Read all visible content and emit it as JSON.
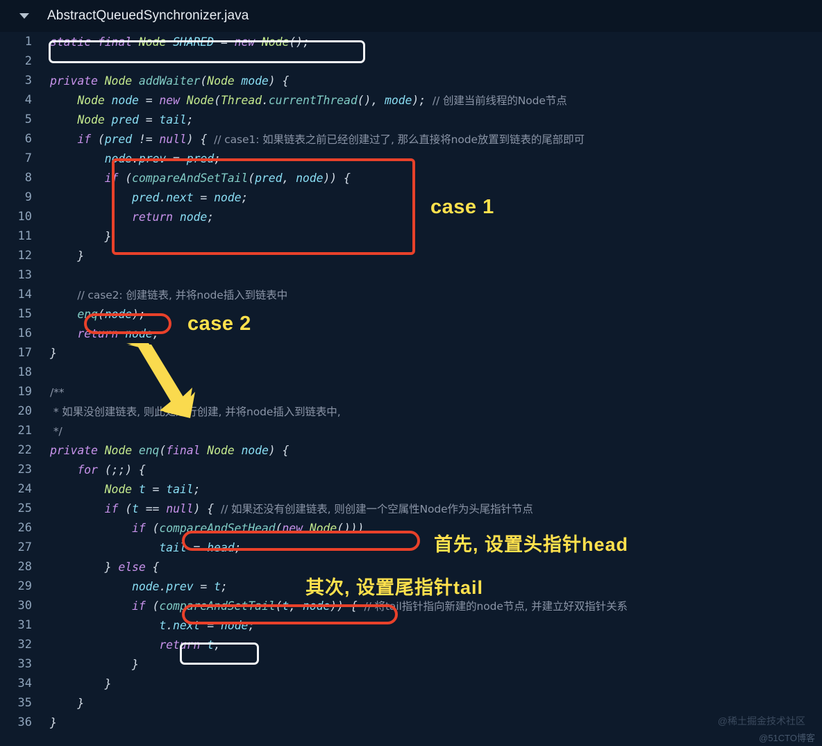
{
  "titlebar": {
    "filename": "AbstractQueuedSynchronizer.java",
    "fold_icon": "chevron-down-icon"
  },
  "editor": {
    "language": "java",
    "first_line": 1,
    "last_line": 36,
    "lines": [
      {
        "n": "1",
        "fold": false,
        "text": "static final Node SHARED = new Node();"
      },
      {
        "n": "2",
        "fold": false,
        "text": ""
      },
      {
        "n": "3",
        "fold": false,
        "text": "private Node addWaiter(Node mode) {"
      },
      {
        "n": "4",
        "fold": false,
        "text": "    Node node = new Node(Thread.currentThread(), mode); // 创建当前线程的Node节点"
      },
      {
        "n": "5",
        "fold": false,
        "text": "    Node pred = tail;"
      },
      {
        "n": "6",
        "fold": true,
        "text": "    if (pred != null) { // case1: 如果链表之前已经创建过了, 那么直接将node放置到链表的尾部即可"
      },
      {
        "n": "7",
        "fold": false,
        "text": "        node.prev = pred;"
      },
      {
        "n": "8",
        "fold": true,
        "text": "        if (compareAndSetTail(pred, node)) {"
      },
      {
        "n": "9",
        "fold": false,
        "text": "            pred.next = node;"
      },
      {
        "n": "10",
        "fold": false,
        "text": "            return node;"
      },
      {
        "n": "11",
        "fold": false,
        "text": "        }"
      },
      {
        "n": "12",
        "fold": false,
        "text": "    }"
      },
      {
        "n": "13",
        "fold": false,
        "text": ""
      },
      {
        "n": "14",
        "fold": false,
        "text": "    // case2: 创建链表, 并将node插入到链表中"
      },
      {
        "n": "15",
        "fold": false,
        "text": "    enq(node);"
      },
      {
        "n": "16",
        "fold": false,
        "text": "    return node;"
      },
      {
        "n": "17",
        "fold": false,
        "text": "}"
      },
      {
        "n": "18",
        "fold": false,
        "text": ""
      },
      {
        "n": "19",
        "fold": true,
        "text": "/**"
      },
      {
        "n": "20",
        "fold": false,
        "text": " * 如果没创建链表, 则此处进行创建, 并将node插入到链表中,"
      },
      {
        "n": "21",
        "fold": false,
        "text": " */"
      },
      {
        "n": "22",
        "fold": true,
        "text": "private Node enq(final Node node) {"
      },
      {
        "n": "23",
        "fold": true,
        "text": "    for (;;) {"
      },
      {
        "n": "24",
        "fold": false,
        "text": "        Node t = tail;"
      },
      {
        "n": "25",
        "fold": true,
        "text": "        if (t == null) { // 如果还没有创建链表, 则创建一个空属性Node作为头尾指针节点"
      },
      {
        "n": "26",
        "fold": false,
        "text": "            if (compareAndSetHead(new Node()))"
      },
      {
        "n": "27",
        "fold": false,
        "text": "                tail = head;"
      },
      {
        "n": "28",
        "fold": true,
        "text": "        } else {"
      },
      {
        "n": "29",
        "fold": false,
        "text": "            node.prev = t;"
      },
      {
        "n": "30",
        "fold": true,
        "text": "            if (compareAndSetTail(t, node)) { // 将tail指针指向新建的node节点, 并建立好双指针关系"
      },
      {
        "n": "31",
        "fold": false,
        "text": "                t.next = node;"
      },
      {
        "n": "32",
        "fold": false,
        "text": "                return t;"
      },
      {
        "n": "33",
        "fold": false,
        "text": "            }"
      },
      {
        "n": "34",
        "fold": false,
        "text": "        }"
      },
      {
        "n": "35",
        "fold": false,
        "text": "    }"
      },
      {
        "n": "36",
        "fold": false,
        "text": "}"
      }
    ]
  },
  "annotations": {
    "case1_label": "case 1",
    "case2_label": "case 2",
    "head_label": "首先, 设置头指针head",
    "tail_label": "其次, 设置尾指针tail",
    "arrow_icon": "down-right-arrow-icon"
  },
  "highlights": {
    "line1_white_box": "static final Node SHARED = new Node();",
    "case1_red_box": "lines 7-11",
    "enq_red_pill": "enq(node);",
    "cash_head_red_pill": "compareAndSetHead(new Node())",
    "cash_tail_red_pill": "compareAndSetTail(t, node)",
    "return_t_white_box": "return t;"
  },
  "watermarks": {
    "primary": "@稀土掘金技术社区",
    "secondary": "@51CTO博客"
  },
  "colors": {
    "background": "#0d1a2b",
    "titlebar": "#0a1523",
    "keyword": "#c792ea",
    "type": "#c3e88d",
    "function": "#82aaff",
    "method": "#80cbc4",
    "variable": "#89ddf3",
    "comment": "#8a94a6",
    "accent_red": "#e8412a",
    "accent_yellow": "#ffe14d",
    "box_white": "#f2f4f7"
  }
}
